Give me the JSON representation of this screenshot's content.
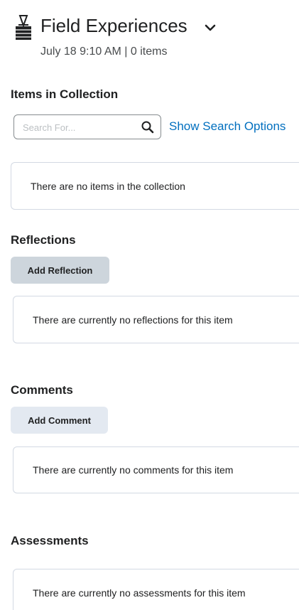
{
  "header": {
    "title": "Field Experiences",
    "title_icon": "binder-clip-icon",
    "expand_icon": "chevron-down-icon",
    "meta": "July 18 9:10 AM | 0 items"
  },
  "collection": {
    "heading": "Items in Collection",
    "search_placeholder": "Search For...",
    "search_value": "",
    "search_icon": "search-icon",
    "show_options_label": "Show Search Options",
    "empty_message": "There are no items in the collection"
  },
  "reflections": {
    "heading": "Reflections",
    "add_label": "Add Reflection",
    "empty_message": "There are currently no reflections for this item"
  },
  "comments": {
    "heading": "Comments",
    "add_label": "Add Comment",
    "empty_message": "There are currently no comments for this item"
  },
  "assessments": {
    "heading": "Assessments",
    "empty_message": "There are currently no assessments for this item"
  },
  "colors": {
    "link": "#006fbf",
    "text": "#202122",
    "panel_border": "#d3d9e3",
    "reflection_button": "#cdd5dc",
    "comment_button": "#e3e9f1"
  }
}
